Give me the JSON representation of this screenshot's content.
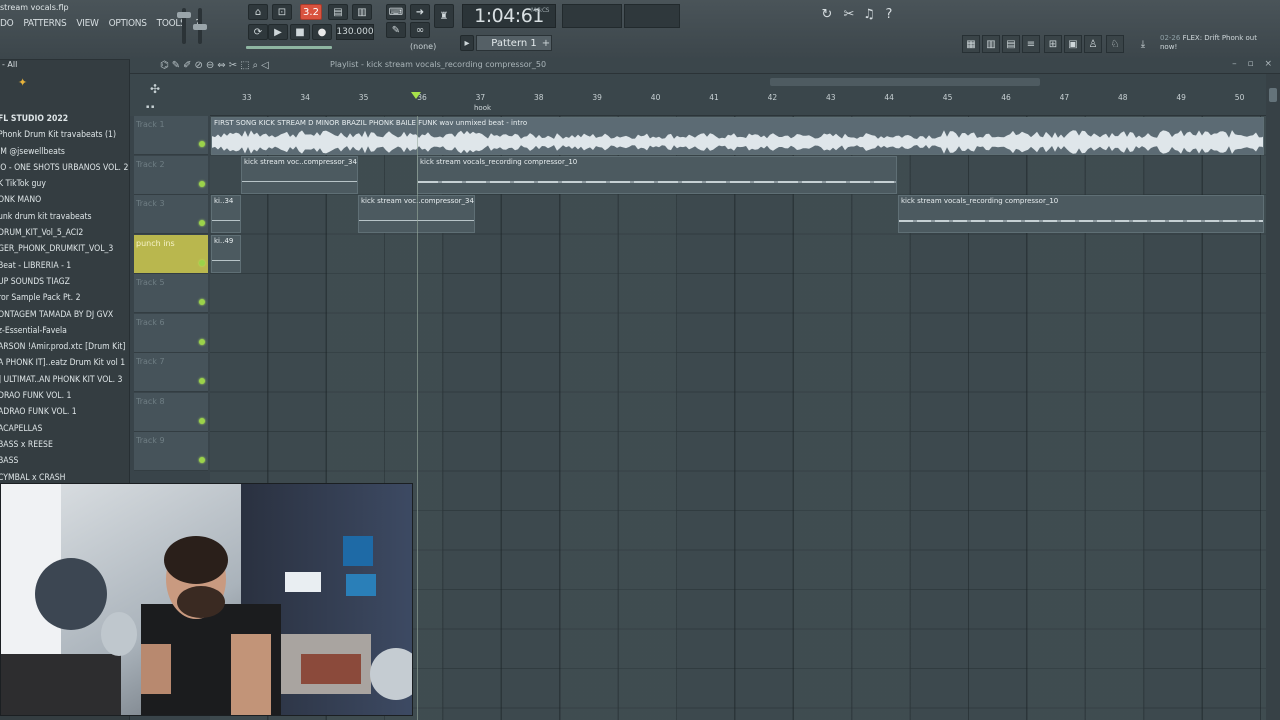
{
  "window": {
    "project_title": "stream vocals.flp"
  },
  "menu": [
    "DO",
    "PATTERNS",
    "VIEW",
    "OPTIONS",
    "TOOLS",
    "?"
  ],
  "transport": {
    "pat_song": "3.2",
    "tempo": "130.000",
    "time": "1:04:61",
    "time_unit": "M:S:CS",
    "pattern": "Pattern 1",
    "pattern_add": "+",
    "none_label": "(none)",
    "play_icon": "▶",
    "stop_icon": "■",
    "record_icon": "●"
  },
  "news": {
    "date": "02-26",
    "text": "FLEX: Drift Phonk out now!"
  },
  "browser": {
    "header": "- All",
    "items": [
      "FL STUDIO 2022",
      "Phonk Drum Kit travabeats (1)",
      "IM @jsewellbeats",
      "IO - ONE SHOTS URBANOS VOL. 2",
      "K TikTok guy",
      "ONK MANO",
      "unk drum kit travabeats",
      "DRUM_KIT_Vol_5_ACI2",
      "GER_PHONK_DRUMKIT_VOL_3",
      "Beat - LIBRERIA - 1",
      "UP SOUNDS TIAGZ",
      "ror Sample Pack Pt. 2",
      "ONTAGEM TAMADA BY DJ GVX",
      "z-Essential-Favela",
      "ARSON !Amir.prod.xtc [Drum Kit]",
      "A PHONK IT]..eatz Drum Kit vol 1",
      "] ULTIMAT..AN PHONK KIT VOL. 3",
      "DRAO FUNK VOL. 1",
      "ADRAO FUNK VOL. 1",
      "ACAPELLAS",
      "BASS x REESE",
      "BASS",
      "CYMBAL x CRASH"
    ]
  },
  "playlist": {
    "title": "Playlist - kick stream vocals_recording compressor_50",
    "ruler_numbers": [
      "33",
      "34",
      "35",
      "36",
      "37",
      "38",
      "39",
      "40",
      "41",
      "42",
      "43",
      "44",
      "45",
      "46",
      "47",
      "48",
      "49",
      "50"
    ],
    "marker": "hook",
    "tracks": [
      {
        "name": "Track 1"
      },
      {
        "name": "Track 2"
      },
      {
        "name": "Track 3"
      },
      {
        "name": "punch ins"
      },
      {
        "name": "Track 5"
      },
      {
        "name": "Track 6"
      },
      {
        "name": "Track 7"
      },
      {
        "name": "Track 8"
      },
      {
        "name": "Track 9"
      }
    ],
    "clips": [
      {
        "label": "FIRST SONG KICK STREAM D MINOR BRAZIL PHONK BAILE FUNK wav unmixed beat - intro"
      },
      {
        "label": "kick stream voc..compressor_34"
      },
      {
        "label": "kick stream vocals_recording compressor_10"
      },
      {
        "label": "ki..34"
      },
      {
        "label": "kick stream voc..compressor_34"
      },
      {
        "label": "kick stream vocals_recording compressor_10"
      },
      {
        "label": "ki..49"
      }
    ]
  },
  "colors": {
    "accent_green": "#9bd24a",
    "record_red": "#d9533f",
    "punch_track": "#b9b74e"
  }
}
